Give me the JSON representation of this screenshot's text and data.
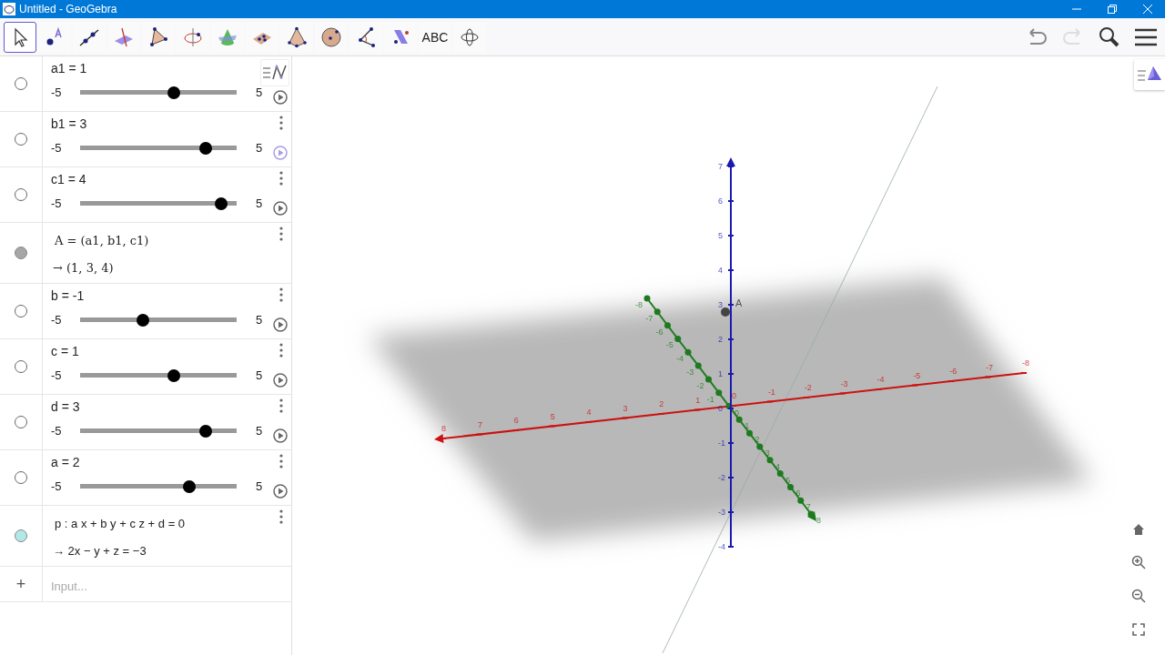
{
  "window": {
    "title": "Untitled - GeoGebra"
  },
  "toolbar": {
    "tools": [
      {
        "kind": "move",
        "selected": true
      },
      {
        "kind": "point",
        "selected": false
      },
      {
        "kind": "line",
        "selected": false
      },
      {
        "kind": "intersect",
        "selected": false
      },
      {
        "kind": "polygon",
        "selected": false
      },
      {
        "kind": "rotate-axis",
        "selected": false
      },
      {
        "kind": "cone",
        "selected": false
      },
      {
        "kind": "plane",
        "selected": false
      },
      {
        "kind": "pyramid",
        "selected": false
      },
      {
        "kind": "sphere",
        "selected": false
      },
      {
        "kind": "angle",
        "selected": false
      },
      {
        "kind": "parallel",
        "selected": false
      },
      {
        "kind": "text",
        "label": "ABC",
        "selected": false
      },
      {
        "kind": "view-rotate",
        "selected": false
      }
    ],
    "undo_disabled": false,
    "redo_disabled": true
  },
  "algebra": {
    "items": [
      {
        "kind": "slider",
        "visible": false,
        "label": "a1 = 1",
        "min": "-5",
        "max": "5",
        "level": 0.6,
        "play_highlighted": false
      },
      {
        "kind": "slider",
        "visible": false,
        "menu": true,
        "label": "b1 = 3",
        "min": "-5",
        "max": "5",
        "level": 0.8,
        "play_highlighted": true
      },
      {
        "kind": "slider",
        "visible": false,
        "menu": true,
        "label": "c1 = 4",
        "min": "-5",
        "max": "5",
        "level": 0.9,
        "play_highlighted": false
      },
      {
        "kind": "formula",
        "visible": true,
        "menu": true,
        "color": "#a6a6a6",
        "definition": "A = (a1, b1, c1)",
        "output": "→ (1, 3, 4)"
      },
      {
        "kind": "slider",
        "visible": false,
        "menu": true,
        "label": "b = -1",
        "min": "-5",
        "max": "5",
        "level": 0.4,
        "play_highlighted": false
      },
      {
        "kind": "slider",
        "visible": false,
        "menu": true,
        "label": "c = 1",
        "min": "-5",
        "max": "5",
        "level": 0.6,
        "play_highlighted": false
      },
      {
        "kind": "slider",
        "visible": false,
        "menu": true,
        "label": "d = 3",
        "min": "-5",
        "max": "5",
        "level": 0.8,
        "play_highlighted": false
      },
      {
        "kind": "slider",
        "visible": false,
        "menu": true,
        "label": "a = 2",
        "min": "-5",
        "max": "5",
        "level": 0.7,
        "play_highlighted": false
      },
      {
        "kind": "formula",
        "visible": true,
        "menu": true,
        "color": "#b4e8e8",
        "definition": "p : a x + b y + c z + d = 0",
        "output": "→ 2x − y + z = −3"
      }
    ],
    "input": {
      "add_label": "+",
      "placeholder": "Input..."
    }
  },
  "graphics": {
    "x_axis": [
      "8",
      "7",
      "6",
      "5",
      "4",
      "3",
      "2",
      "1",
      "0",
      "-1",
      "-2",
      "-3",
      "-4",
      "-5",
      "-6",
      "-7",
      "-8"
    ],
    "y_axis": [
      "-8",
      "-7",
      "-6",
      "-5",
      "-4",
      "-3",
      "-2",
      "-1",
      "0",
      "1",
      "2",
      "3",
      "4",
      "5",
      "6",
      "7",
      "8"
    ],
    "z_axis": [
      "7",
      "6",
      "5",
      "4",
      "3",
      "2",
      "1",
      "0",
      "-1",
      "-2",
      "-3",
      "-4"
    ],
    "points": [
      {
        "label": "A"
      }
    ]
  }
}
